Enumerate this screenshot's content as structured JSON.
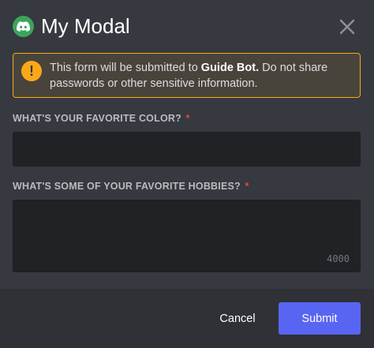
{
  "modal": {
    "title": "My Modal",
    "icon": "discord-icon",
    "close_icon": "close-icon",
    "accent_color": "#3ba55c"
  },
  "warning": {
    "icon": "exclamation-icon",
    "text_before": "This form will be submitted to ",
    "bot_name": "Guide Bot.",
    "text_after": " Do not share passwords or other sensitive information.",
    "color": "#faa81a"
  },
  "fields": [
    {
      "label": "WHAT'S YOUR FAVORITE COLOR?",
      "required_mark": "*",
      "value": ""
    },
    {
      "label": "WHAT'S SOME OF YOUR FAVORITE HOBBIES?",
      "required_mark": "*",
      "value": "",
      "char_limit": "4000"
    }
  ],
  "footer": {
    "cancel_label": "Cancel",
    "submit_label": "Submit",
    "submit_color": "#5865f2"
  }
}
